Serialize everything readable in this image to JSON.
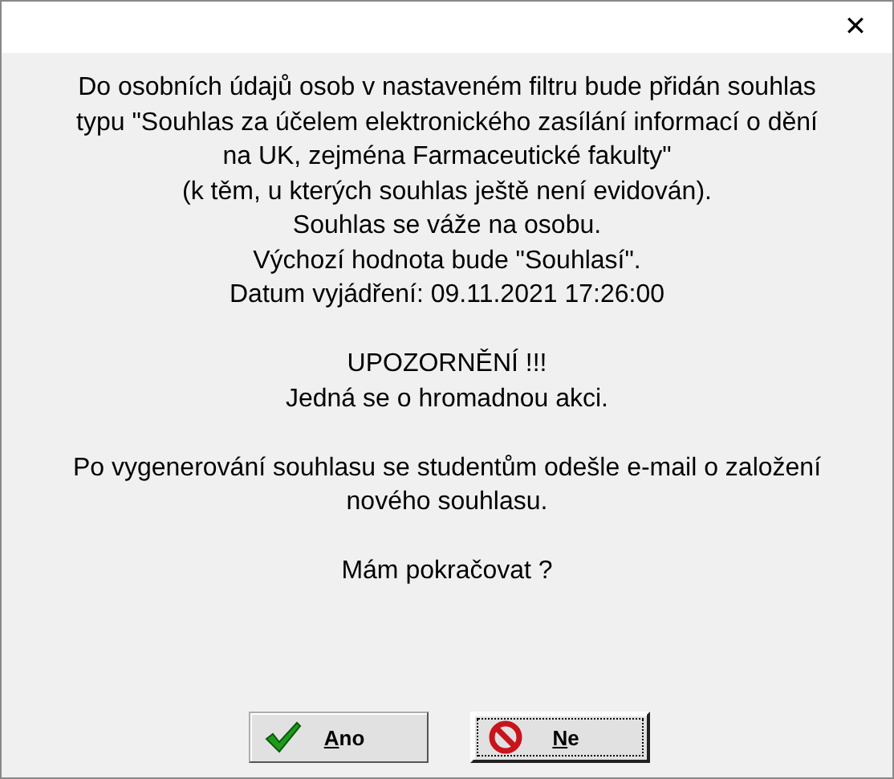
{
  "window": {
    "close": "✕"
  },
  "message": [
    {
      "lines": [
        "Do osobních údajů osob v nastaveném filtru bude přidán souhlas",
        "typu \"Souhlas za účelem elektronického zasílání informací o dění",
        "na UK, zejména Farmaceutické fakulty\"",
        "(k těm, u kterých souhlas ještě není evidován).",
        "Souhlas se váže na osobu.",
        "Výchozí hodnota bude \"Souhlasí\".",
        "Datum vyjádření: 09.11.2021 17:26:00"
      ]
    },
    {
      "lines": [
        "UPOZORNĚNÍ !!!",
        "Jedná se o hromadnou akci."
      ]
    },
    {
      "lines": [
        "Po vygenerování souhlasu se studentům odešle e-mail o založení",
        "nového souhlasu."
      ]
    },
    {
      "lines": [
        "Mám pokračovat ?"
      ]
    }
  ],
  "buttons": [
    {
      "label": "Ano",
      "kind": "yes",
      "default": false,
      "mnemonic": true
    },
    {
      "label": "Ne",
      "kind": "no",
      "default": true,
      "mnemonic": true
    }
  ]
}
